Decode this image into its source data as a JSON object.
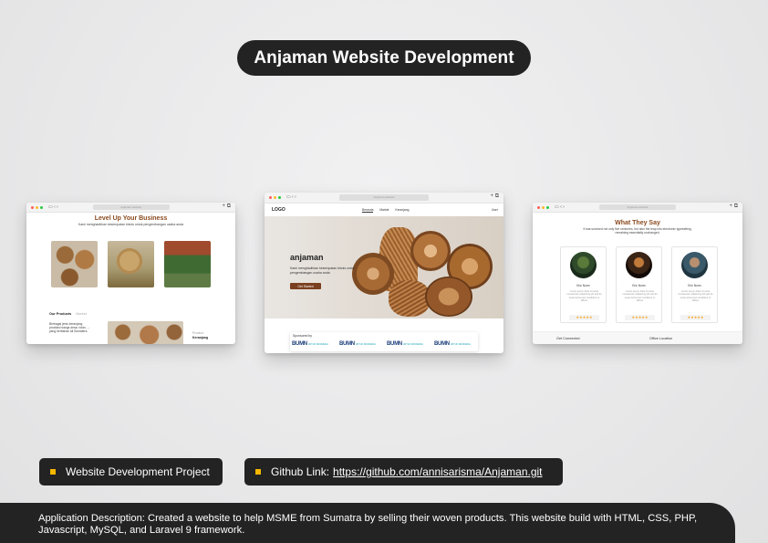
{
  "title": "Anjaman Website Development",
  "left_window": {
    "url": "Anjaman.website",
    "heading": "Level Up Your Business",
    "subheading": "Kami menghadirkan kesempatan bisnis untuk pengembangan usaha anda",
    "tab_active": "Our Products",
    "tab_inactive": "Market",
    "product_text": "Berbagai jenis keranjang produksi warga desa: rotan, ... yang berbahan ali Sumatera",
    "meta_label": "Product",
    "meta_value": "Keranjang"
  },
  "center_window": {
    "url": "Anjaman.website",
    "logo": "LOGO",
    "nav_links": [
      "Beranda",
      "Market",
      "Keranjang"
    ],
    "nav_end": "User",
    "hero_title": "anjaman",
    "hero_desc": "Kami menghadirkan kesempatan bisnis untuk pengembangan usaha anda",
    "cta": "Get Started",
    "sponsor_label": "Sponsored by",
    "sponsors": [
      "BUMN",
      "BUMN",
      "BUMN",
      "BUMN"
    ],
    "sponsor_sub": "UNTUK INDONESIA"
  },
  "right_window": {
    "url": "Anjaman.website",
    "heading": "What They Say",
    "subheading": "It has survived not only five centuries, but also the leap into electronic typesetting, remaining essentially unchanged.",
    "cards": [
      {
        "name": "Eric Norm",
        "text": "Lorem ipsum dolor sit amet consectetur adipiscing elit sed do eiusmod tempor incididunt ut labore",
        "stars": "★★★★★"
      },
      {
        "name": "Eric Norm",
        "text": "Lorem ipsum dolor sit amet consectetur adipiscing elit sed do eiusmod tempor incididunt ut labore",
        "stars": "★★★★★"
      },
      {
        "name": "Eric Norm",
        "text": "Lorem ipsum dolor sit amet consectetur adipiscing elit sed do eiusmod tempor incididunt ut labore",
        "stars": "★★★★★"
      }
    ],
    "footer_left": "Get Connected",
    "footer_right": "Office Location"
  },
  "tags": {
    "project": "Website Development Project",
    "github_label": "Github Link:",
    "github_url": "https://github.com/annisarisma/Anjaman.git"
  },
  "description": "Application Description: Created a website to help MSME from Sumatra by selling their woven products. This website build with HTML, CSS, PHP, Javascript, MySQL, and Laravel 9 framework.",
  "colors": {
    "accent": "#f5b700",
    "brand_brown": "#8a4a1e",
    "dark": "#232323"
  }
}
